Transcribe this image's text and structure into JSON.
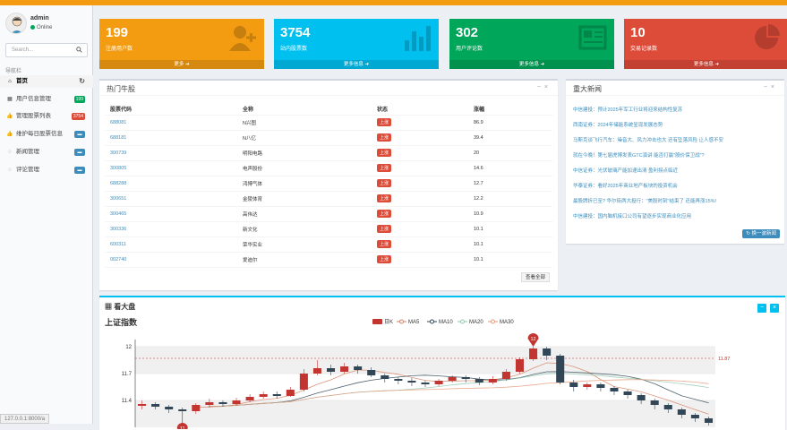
{
  "user": {
    "name": "admin",
    "status": "Online"
  },
  "search": {
    "placeholder": "Search..."
  },
  "nav_header": "导航栏",
  "nav": [
    {
      "label": "首页"
    },
    {
      "label": "用户信息管理",
      "badge": "199",
      "color": "#00a65a"
    },
    {
      "label": "管理股票列表",
      "badge": "3754",
      "color": "#dd4b39"
    },
    {
      "label": "维护每日股票信息",
      "badge": "",
      "color": "#3c8dbc"
    },
    {
      "label": "新闻管理",
      "badge": "",
      "color": "#3c8dbc"
    },
    {
      "label": "评论管理",
      "badge": "",
      "color": "#3c8dbc"
    }
  ],
  "status_url": "127.0.0.1:8000/a",
  "stats": [
    {
      "value": "199",
      "label": "注册用户数",
      "more": "更多 ➜",
      "color": "#f39c12"
    },
    {
      "value": "3754",
      "label": "站内股票数",
      "more": "更多信息 ➜",
      "color": "#00c0ef"
    },
    {
      "value": "302",
      "label": "用户评论数",
      "more": "更多信息 ➜",
      "color": "#00a65a"
    },
    {
      "value": "10",
      "label": "交易记录数",
      "more": "更多信息 ➜",
      "color": "#dd4b39"
    }
  ],
  "hot": {
    "title": "热门牛股",
    "columns": [
      "股票代码",
      "全称",
      "状态",
      "涨幅"
    ],
    "rows": [
      {
        "code": "688081",
        "name": "N兴图",
        "status": "上涨",
        "change": "86.9"
      },
      {
        "code": "688181",
        "name": "N八亿",
        "status": "上涨",
        "change": "39.4"
      },
      {
        "code": "300739",
        "name": "明阳电路",
        "status": "上涨",
        "change": "20"
      },
      {
        "code": "300805",
        "name": "电声股份",
        "status": "上涨",
        "change": "14.6"
      },
      {
        "code": "688288",
        "name": "鸿博气体",
        "status": "上涨",
        "change": "12.7"
      },
      {
        "code": "300651",
        "name": "金陵体育",
        "status": "上涨",
        "change": "12.2"
      },
      {
        "code": "300465",
        "name": "高伟达",
        "status": "上涨",
        "change": "10.9"
      },
      {
        "code": "300336",
        "name": "新文化",
        "status": "上涨",
        "change": "10.1"
      },
      {
        "code": "600311",
        "name": "荣华实业",
        "status": "上涨",
        "change": "10.1"
      },
      {
        "code": "002740",
        "name": "爱迪尔",
        "status": "上涨",
        "change": "10.1"
      }
    ],
    "view_all": "查看全部"
  },
  "news": {
    "title": "重大新闻",
    "items": [
      "中信建投：预计2025年军工行业将迎来结构性复苏",
      "西南证券：2024年储能系统呈现发展态势",
      "马斯克谈飞行汽车：噪音大、风力冲击也大 还有坠落风险 让人感不安",
      "就在今晚！第七届虎博发表GTC演讲 能否打赢\"股价保卫战\"?",
      "中信证券：光伏玻璃产能加速出清 盈利拐点临近",
      "华泰证券：看好2025年商业地产板块的投资机会",
      "最股牌折已至? 华尔街两大投行：\"美股时刻\"结束了 还能再涨15%!",
      "中信建投：国内脑机接口公司有望逐步实现商业化应用"
    ],
    "more": "换一波新闻"
  },
  "market": {
    "title": "看大盘"
  },
  "chart_data": {
    "type": "candlestick",
    "title": "上证指数",
    "legend": [
      "日K",
      "MA5",
      "MA10",
      "MA20",
      "MA30"
    ],
    "series_colors": {
      "日K": "#c23531",
      "MA5": "#d48265",
      "MA10": "#2f4554",
      "MA20": "#91c7ae",
      "MA30": "#e59a7a"
    },
    "y_ticks": [
      12,
      11.7,
      11.4
    ],
    "ylim": [
      11.1,
      12.05
    ],
    "max_marker": {
      "index": 29,
      "value": 12
    },
    "min_marker": {
      "index": 3,
      "value": 11
    },
    "markline": {
      "value": 11.87,
      "label": "11.87"
    },
    "candles": [
      [
        11.34,
        11.36,
        11.3,
        11.4
      ],
      [
        11.36,
        11.33,
        11.3,
        11.38
      ],
      [
        11.33,
        11.3,
        11.26,
        11.35
      ],
      [
        11.3,
        11.28,
        11.0,
        11.32
      ],
      [
        11.28,
        11.35,
        11.25,
        11.37
      ],
      [
        11.35,
        11.38,
        11.32,
        11.42
      ],
      [
        11.38,
        11.36,
        11.33,
        11.4
      ],
      [
        11.36,
        11.4,
        11.34,
        11.43
      ],
      [
        11.4,
        11.44,
        11.38,
        11.47
      ],
      [
        11.44,
        11.47,
        11.42,
        11.5
      ],
      [
        11.47,
        11.45,
        11.42,
        11.5
      ],
      [
        11.45,
        11.52,
        11.44,
        11.55
      ],
      [
        11.52,
        11.7,
        11.5,
        11.75
      ],
      [
        11.7,
        11.76,
        11.68,
        11.85
      ],
      [
        11.76,
        11.72,
        11.68,
        11.8
      ],
      [
        11.72,
        11.78,
        11.7,
        11.82
      ],
      [
        11.78,
        11.74,
        11.7,
        11.8
      ],
      [
        11.74,
        11.68,
        11.66,
        11.77
      ],
      [
        11.68,
        11.64,
        11.6,
        11.7
      ],
      [
        11.64,
        11.62,
        11.58,
        11.66
      ],
      [
        11.62,
        11.6,
        11.56,
        11.65
      ],
      [
        11.6,
        11.58,
        11.55,
        11.62
      ],
      [
        11.58,
        11.62,
        11.56,
        11.64
      ],
      [
        11.62,
        11.66,
        11.6,
        11.68
      ],
      [
        11.66,
        11.64,
        11.6,
        11.68
      ],
      [
        11.64,
        11.6,
        11.57,
        11.66
      ],
      [
        11.6,
        11.64,
        11.58,
        11.67
      ],
      [
        11.64,
        11.72,
        11.62,
        11.75
      ],
      [
        11.72,
        11.86,
        11.7,
        11.88
      ],
      [
        11.86,
        11.98,
        11.84,
        12.0
      ],
      [
        11.98,
        11.9,
        11.85,
        12.0
      ],
      [
        11.9,
        11.6,
        11.58,
        11.92
      ],
      [
        11.6,
        11.55,
        11.5,
        11.63
      ],
      [
        11.55,
        11.58,
        11.52,
        11.6
      ],
      [
        11.58,
        11.54,
        11.5,
        11.6
      ],
      [
        11.54,
        11.5,
        11.46,
        11.56
      ],
      [
        11.5,
        11.46,
        11.42,
        11.52
      ],
      [
        11.46,
        11.4,
        11.36,
        11.48
      ],
      [
        11.4,
        11.35,
        11.3,
        11.42
      ],
      [
        11.35,
        11.3,
        11.26,
        11.37
      ],
      [
        11.3,
        11.24,
        11.2,
        11.32
      ],
      [
        11.24,
        11.2,
        11.16,
        11.26
      ],
      [
        11.2,
        11.15,
        11.12,
        11.22
      ]
    ]
  }
}
